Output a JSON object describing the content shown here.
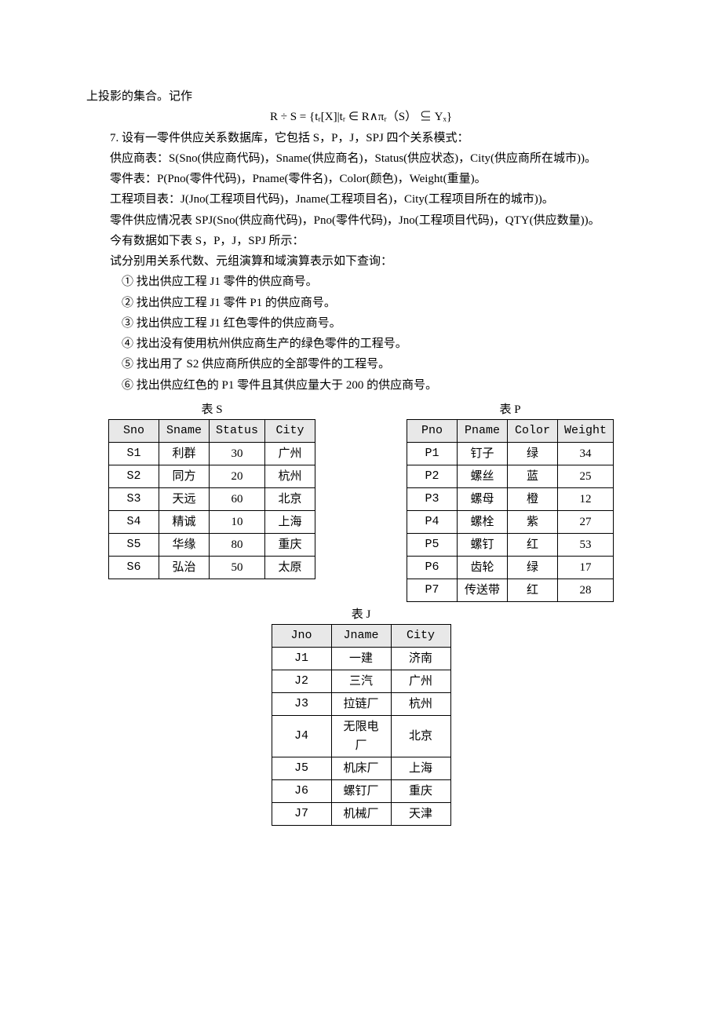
{
  "p_top": "上投影的集合。记作",
  "formula": "R ÷ S = {tᵣ[X]|tᵣ ∈ R∧πᵣ（S） ⊆ Yₓ}",
  "p7_a": "7. 设有一零件供应关系数据库，它包括 S，P，J，SPJ 四个关系模式：",
  "p7_b": "供应商表：S(Sno(供应商代码)，Sname(供应商名)，Status(供应状态)，City(供应商所在城市))。",
  "p7_c": "零件表：P(Pno(零件代码)，Pname(零件名)，Color(颜色)，Weight(重量)。",
  "p7_d": "工程项目表：J(Jno(工程项目代码)，Jname(工程项目名)，City(工程项目所在的城市))。",
  "p7_e": "零件供应情况表 SPJ(Sno(供应商代码)，Pno(零件代码)，Jno(工程项目代码)，QTY(供应数量))。",
  "p7_f": "今有数据如下表 S，P，J，SPJ 所示：",
  "p7_g": "试分别用关系代数、元组演算和域演算表示如下查询：",
  "q1": "①  找出供应工程 J1 零件的供应商号。",
  "q2": "②  找出供应工程 J1 零件 P1 的供应商号。",
  "q3": "③  找出供应工程 J1 红色零件的供应商号。",
  "q4": "④  找出没有使用杭州供应商生产的绿色零件的工程号。",
  "q5": "⑤  找出用了 S2 供应商所供应的全部零件的工程号。",
  "q6": "⑥  找出供应红色的 P1 零件且其供应量大于 200 的供应商号。",
  "tableS": {
    "caption": "表 S",
    "headers": [
      "Sno",
      "Sname",
      "Status",
      "City"
    ],
    "rows": [
      [
        "S1",
        "利群",
        "30",
        "广州"
      ],
      [
        "S2",
        "同方",
        "20",
        "杭州"
      ],
      [
        "S3",
        "天远",
        "60",
        "北京"
      ],
      [
        "S4",
        "精诚",
        "10",
        "上海"
      ],
      [
        "S5",
        "华缘",
        "80",
        "重庆"
      ],
      [
        "S6",
        "弘治",
        "50",
        "太原"
      ]
    ]
  },
  "tableP": {
    "caption": "表 P",
    "headers": [
      "Pno",
      "Pname",
      "Color",
      "Weight"
    ],
    "rows": [
      [
        "P1",
        "钉子",
        "绿",
        "34"
      ],
      [
        "P2",
        "螺丝",
        "蓝",
        "25"
      ],
      [
        "P3",
        "螺母",
        "橙",
        "12"
      ],
      [
        "P4",
        "螺栓",
        "紫",
        "27"
      ],
      [
        "P5",
        "螺钉",
        "红",
        "53"
      ],
      [
        "P6",
        "齿轮",
        "绿",
        "17"
      ],
      [
        "P7",
        "传送带",
        "红",
        "28"
      ]
    ]
  },
  "tableJ": {
    "caption": "表 J",
    "headers": [
      "Jno",
      "Jname",
      "City"
    ],
    "rows": [
      [
        "J1",
        "一建",
        "济南"
      ],
      [
        "J2",
        "三汽",
        "广州"
      ],
      [
        "J3",
        "拉链厂",
        "杭州"
      ],
      [
        "J4",
        "无限电厂",
        "北京"
      ],
      [
        "J5",
        "机床厂",
        "上海"
      ],
      [
        "J6",
        "螺钉厂",
        "重庆"
      ],
      [
        "J7",
        "机械厂",
        "天津"
      ]
    ]
  }
}
